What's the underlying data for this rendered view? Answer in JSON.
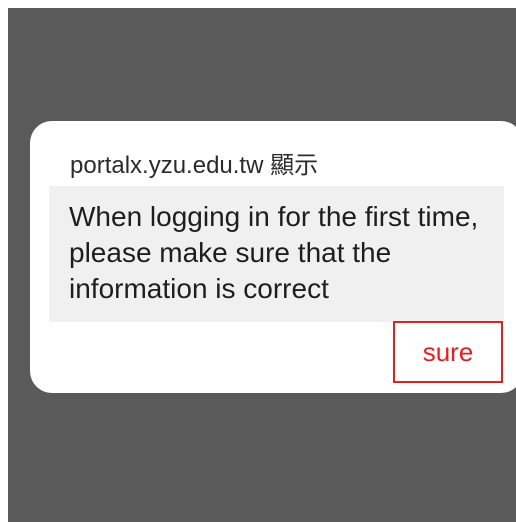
{
  "dialog": {
    "title": "portalx.yzu.edu.tw 顯示",
    "message": "When logging in for the first time, please make sure that the information is correct",
    "confirm_label": "sure"
  },
  "colors": {
    "overlay": "#5a5a5a",
    "dialog_background": "#ffffff",
    "message_background": "#f0f0f0",
    "button_accent": "#e81e1e"
  }
}
